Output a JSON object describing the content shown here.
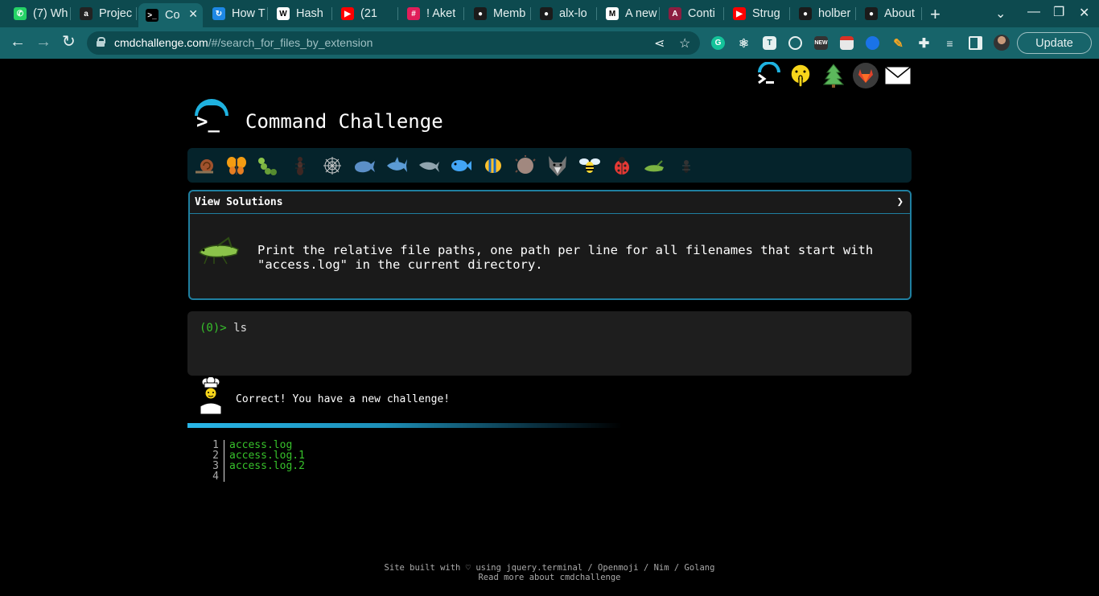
{
  "browser": {
    "tabs": [
      {
        "title": "(7) Wh",
        "icon": "whatsapp-icon",
        "color": "#25d366",
        "glyph": "✆"
      },
      {
        "title": "Projec",
        "icon": "alx-icon",
        "color": "#222222",
        "glyph": "a"
      },
      {
        "title": "Co",
        "icon": "terminal-icon",
        "color": "#000000",
        "glyph": ">_",
        "active": true
      },
      {
        "title": "How T",
        "icon": "loop-icon",
        "color": "#1e88e5",
        "glyph": "↻"
      },
      {
        "title": "Hash",
        "icon": "wikipedia-icon",
        "color": "#ffffff",
        "glyph": "W"
      },
      {
        "title": "(21",
        "icon": "youtube-icon",
        "color": "#ff0000",
        "glyph": "▶"
      },
      {
        "title": "! Aket",
        "icon": "slack-icon",
        "color": "#e01e5a",
        "glyph": "#"
      },
      {
        "title": "Memb",
        "icon": "github-icon",
        "color": "#1b1b1b",
        "glyph": "●"
      },
      {
        "title": "alx-lo",
        "icon": "github-icon",
        "color": "#1b1b1b",
        "glyph": "●"
      },
      {
        "title": "A new",
        "icon": "gmail-icon",
        "color": "#ffffff",
        "glyph": "M"
      },
      {
        "title": "Conti",
        "icon": "asu-icon",
        "color": "#8c1d40",
        "glyph": "A"
      },
      {
        "title": "Strug",
        "icon": "youtube-icon",
        "color": "#ff0000",
        "glyph": "▶"
      },
      {
        "title": "holber",
        "icon": "github-icon",
        "color": "#1b1b1b",
        "glyph": "●"
      },
      {
        "title": "About",
        "icon": "github-icon",
        "color": "#1b1b1b",
        "glyph": "●"
      }
    ],
    "url_host": "cmdchallenge.com",
    "url_path": "/#/search_for_files_by_extension",
    "update_label": "Update"
  },
  "page": {
    "title": "Command Challenge",
    "view_solutions_label": "View Solutions",
    "chevron": "❯",
    "challenge_text": "Print the relative file paths, one path per line for all filenames that start with \"access.log\" in the current directory.",
    "prompt": "(0)>",
    "command": "ls",
    "correct_message": "Correct! You have a new challenge!",
    "progress_fraction": 0.6,
    "output": [
      {
        "n": "1",
        "text": "access.log"
      },
      {
        "n": "2",
        "text": "access.log.1"
      },
      {
        "n": "3",
        "text": "access.log.2"
      },
      {
        "n": "4",
        "text": ""
      }
    ],
    "footer_line1": "Site built with ♡ using jquery.terminal / Openmoji / Nim / Golang",
    "footer_line2": "Read more about cmdchallenge",
    "animals": [
      "snail-icon",
      "butterfly-icon",
      "caterpillar-icon",
      "ant-icon",
      "spider-web-icon",
      "whale-icon",
      "shark-icon",
      "dolphin-icon",
      "fish-icon",
      "tropical-fish-icon",
      "blowfish-icon",
      "wolf-icon",
      "bee-icon",
      "ladybug-icon",
      "cricket-icon",
      "beetle-icon"
    ],
    "top_icons": [
      "cmdchallenge-icon",
      "shushing-face-icon",
      "tree-icon",
      "gitlab-icon",
      "envelope-icon"
    ]
  }
}
